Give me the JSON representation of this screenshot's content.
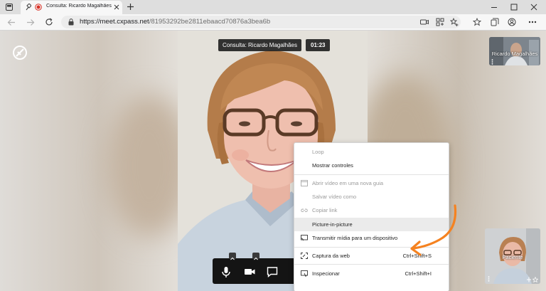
{
  "browser": {
    "tab_title": "Consulta: Ricardo Magalhães",
    "url_host": "https://meet.cxpass.net",
    "url_path": "/81953292be2811ebaacd70876a3bea6b"
  },
  "meeting": {
    "title": "Consulta: Ricardo Magalhães",
    "timer": "01:23",
    "participants": [
      {
        "name": "Ricardo Magalhães"
      },
      {
        "name": "Paciente"
      }
    ]
  },
  "context_menu": {
    "items": [
      {
        "label": "Loop",
        "enabled": false,
        "shortcut": ""
      },
      {
        "label": "Mostrar controles",
        "enabled": true,
        "shortcut": ""
      },
      {
        "label": "Abrir vídeo em uma nova guia",
        "enabled": false,
        "shortcut": ""
      },
      {
        "label": "Salvar vídeo como",
        "enabled": false,
        "shortcut": ""
      },
      {
        "label": "Copiar link",
        "enabled": false,
        "shortcut": ""
      },
      {
        "label": "Picture-in-picture",
        "enabled": true,
        "highlighted": true,
        "shortcut": ""
      },
      {
        "label": "Transmitir mídia para um dispositivo",
        "enabled": true,
        "shortcut": ""
      },
      {
        "label": "Captura da web",
        "enabled": true,
        "shortcut": "Ctrl+Shift+S"
      },
      {
        "label": "Inspecionar",
        "enabled": true,
        "shortcut": "Ctrl+Shift+I"
      }
    ]
  },
  "colors": {
    "annotation_arrow": "#f58220",
    "record_dot": "#d93025",
    "toolbar_bg": "#141414"
  }
}
